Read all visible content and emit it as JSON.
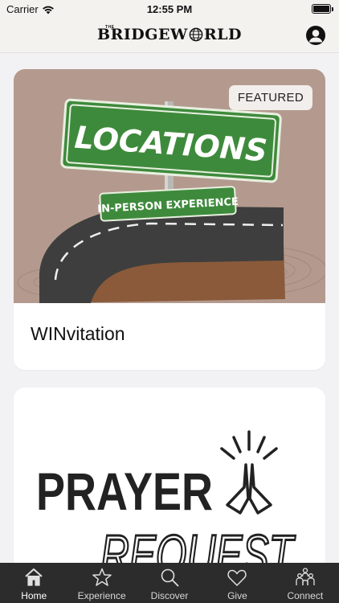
{
  "status_bar": {
    "carrier": "Carrier",
    "time": "12:55 PM"
  },
  "header": {
    "brand_small": "THE",
    "brand_left": "BRIDGE",
    "brand_right": "RLD",
    "brand_w": "W",
    "profile_icon": "person-circle-icon"
  },
  "cards": [
    {
      "badge": "FEATURED",
      "title": "WINvitation",
      "image": {
        "sign_main": "LOCATIONS",
        "sign_sub": "IN-PERSON EXPERIENCE",
        "background": "#b49a8e",
        "sign_color": "#3e8a3c"
      }
    },
    {
      "image": {
        "word_1": "PRAYER",
        "word_2": "REQUEST",
        "icon": "praying-hands-icon"
      }
    }
  ],
  "tabs": [
    {
      "label": "Home",
      "icon": "home-icon",
      "active": true
    },
    {
      "label": "Experience",
      "icon": "star-icon",
      "active": false
    },
    {
      "label": "Discover",
      "icon": "search-icon",
      "active": false
    },
    {
      "label": "Give",
      "icon": "heart-icon",
      "active": false
    },
    {
      "label": "Connect",
      "icon": "people-icon",
      "active": false
    }
  ],
  "colors": {
    "tab_bar": "#2c2c2c",
    "header_bg": "#f4f2ef",
    "page_bg": "#f2f2f4"
  }
}
